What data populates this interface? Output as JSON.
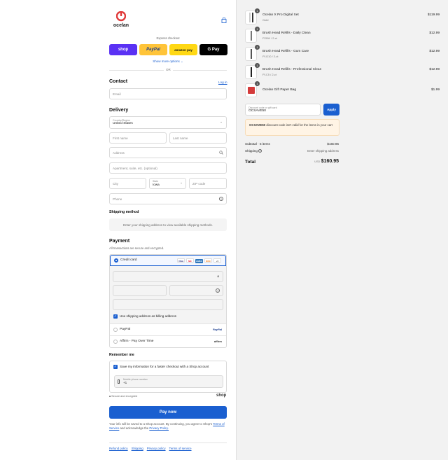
{
  "brand": {
    "name": "ocelan",
    "cart_icon": "bag-icon"
  },
  "express": {
    "heading": "Express checkout",
    "buttons": [
      "shop",
      "PayPal",
      "amazon pay",
      "G Pay"
    ],
    "more": "Show more options",
    "or": "OR"
  },
  "contact": {
    "title": "Contact",
    "login": "Log in",
    "email_placeholder": "Email"
  },
  "delivery": {
    "title": "Delivery",
    "country_label": "Country/Region",
    "country_value": "United States",
    "first_name": "First name",
    "last_name": "Last name",
    "address": "Address",
    "apartment": "Apartment, suite, etc. (optional)",
    "city": "City",
    "state_label": "State",
    "state_value": "Iowa",
    "zip": "ZIP code",
    "phone": "Phone"
  },
  "shipping_method": {
    "title": "Shipping method",
    "message": "Enter your shipping address to view available shipping methods."
  },
  "payment": {
    "title": "Payment",
    "subtitle": "All transactions are secure and encrypted.",
    "credit_card": "Credit card",
    "cards": [
      "VISA",
      "MC",
      "AMEX",
      "DISC",
      "+5"
    ],
    "billing_same": "Use shipping address as billing address",
    "paypal": "PayPal",
    "paypal_logo": "PayPal",
    "affirm": "Affirm - Pay Over Time",
    "affirm_logo": "affirm"
  },
  "remember": {
    "title": "Remember me",
    "save_info": "Save my information for a faster checkout with a Shop account",
    "mobile_label": "Mobile phone number",
    "mobile_value": "+1",
    "secure": "Secure and encrypted",
    "shop": "shop"
  },
  "pay_now": "Pay now",
  "disclaimer": {
    "text": "Your info will be saved to a Shop account. By continuing, you agree to Shop's",
    "tos": "Terms of Service",
    "and": "and acknowledge the",
    "privacy": "Privacy Policy."
  },
  "footer_links": [
    "Refund policy",
    "Shipping",
    "Privacy policy",
    "Terms of service"
  ],
  "cart": {
    "items": [
      {
        "qty": "1",
        "name": "Ocelan X Pro Digital Set",
        "variant": "Gold",
        "price": "$119.99"
      },
      {
        "qty": "1",
        "name": "Brush Head Refills - Daily Clean",
        "variant": "P20W / 2-ct",
        "price": "$12.99"
      },
      {
        "qty": "1",
        "name": "Brush Head Refills - Gum Care",
        "variant": "P1G10 / 2-ct",
        "price": "$12.99"
      },
      {
        "qty": "1",
        "name": "Brush Head Refills - Professional Clean",
        "variant": "P1C5 / 2-ct",
        "price": "$12.99"
      },
      {
        "qty": "1",
        "name": "Ocelan Gift Paper Bag",
        "variant": "",
        "price": "$1.99"
      }
    ],
    "discount_label": "Discount code or gift card",
    "discount_value": "OCSAVE50",
    "apply": "Apply",
    "notice_code": "OCSAVE50",
    "notice_text": "discount code isn't valid for the items in your cart",
    "subtotal_label": "Subtotal · 5 items",
    "subtotal_value": "$160.95",
    "shipping_label": "Shipping",
    "shipping_value": "Enter shipping address",
    "total_label": "Total",
    "currency": "USD",
    "total_value": "$160.95"
  },
  "colors": {
    "accent": "#1a5fd0",
    "shop": "#5a31f4",
    "paypal": "#ffc439",
    "amazon": "#ffd814",
    "gpay": "#000000",
    "notice_bg": "#fff4e5",
    "logo": "#e03a3a"
  }
}
